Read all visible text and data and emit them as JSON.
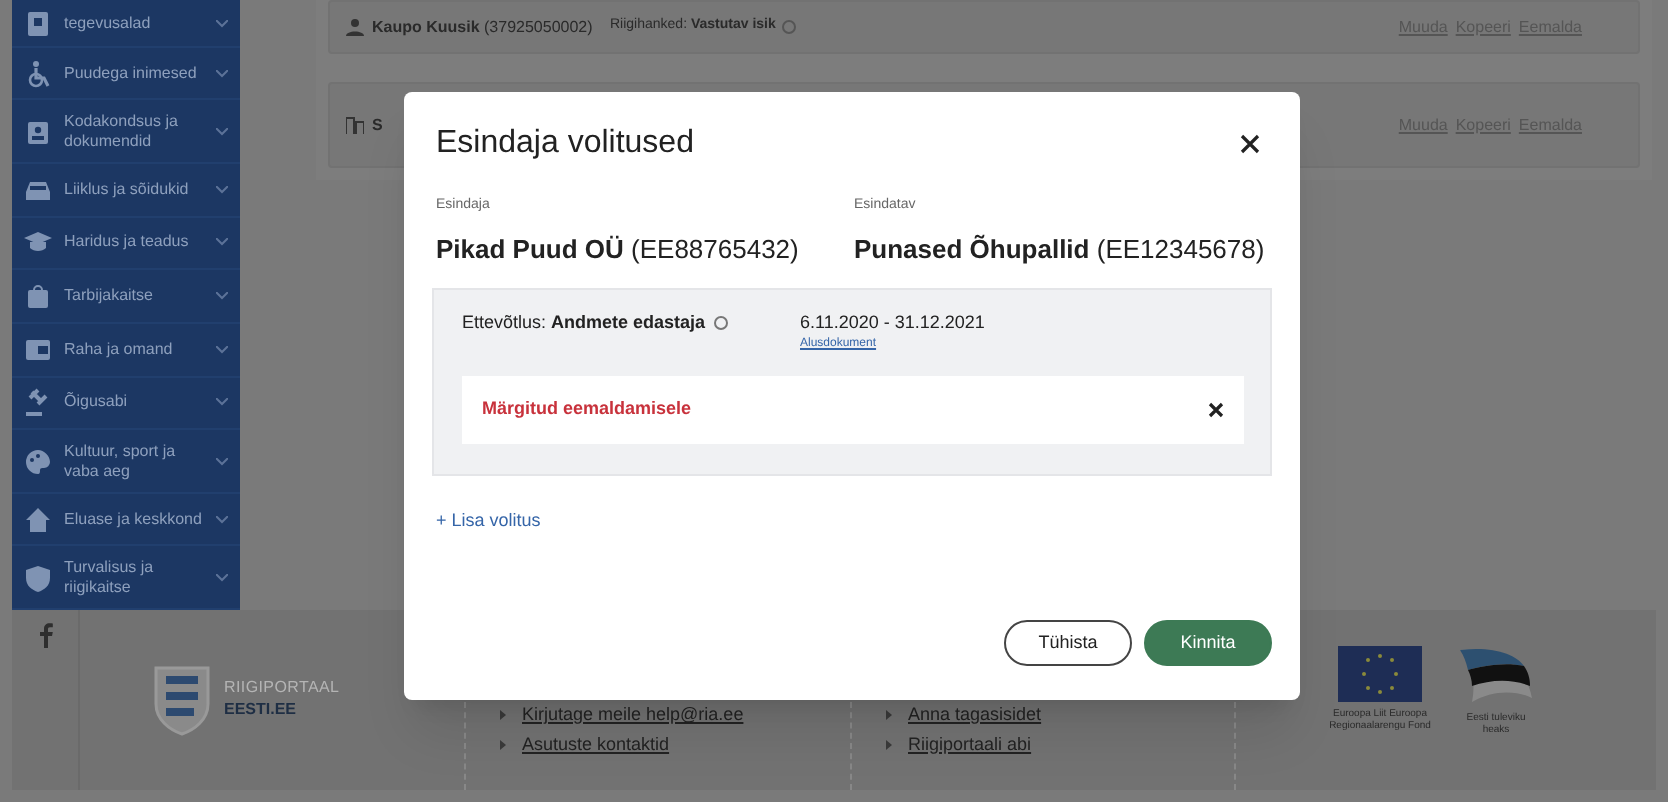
{
  "sidebar": {
    "items": [
      {
        "label": "tegevusalad"
      },
      {
        "label": "Puudega inimesed"
      },
      {
        "label": "Kodakondsus ja dokumendid"
      },
      {
        "label": "Liiklus ja sõidukid"
      },
      {
        "label": "Haridus ja teadus"
      },
      {
        "label": "Tarbijakaitse"
      },
      {
        "label": "Raha ja omand"
      },
      {
        "label": "Õigusabi"
      },
      {
        "label": "Kultuur, sport ja vaba aeg"
      },
      {
        "label": "Eluase ja keskkond"
      },
      {
        "label": "Turvalisus ja riigikaitse"
      }
    ]
  },
  "cards": [
    {
      "name": "**Kaupo Kuusik** (37925050002)",
      "role": "Riigihanked: **Vastutav isik**",
      "actions": [
        "Muuda",
        "Kopeeri",
        "Eemalda"
      ]
    },
    {
      "name": "**S**",
      "actions": [
        "Muuda",
        "Kopeeri",
        "Eemalda"
      ]
    }
  ],
  "footer": {
    "logo": [
      "RIIGIPORTAAL",
      "EESTI.EE"
    ],
    "link_columns": [
      [
        "Kirjutage meile help@ria.ee",
        "Asutuste kontaktid"
      ],
      [
        "Anna tagasisidet",
        "Riigiportaali abi"
      ]
    ],
    "eu_caption": "Euroopa Liit Euroopa Regionaalarengu Fond",
    "ee_caption": "Eesti tuleviku heaks"
  },
  "modal": {
    "title": "Esindaja volitused",
    "parties": [
      {
        "label": "Esindaja",
        "name": "**Pikad Puud OÜ** (EE88765432)"
      },
      {
        "label": "Esindatav",
        "name": "**Punased Õhupallid** (EE12345678)"
      }
    ],
    "permissions": [
      {
        "role": "Ettevõtlus: **Andmete edastaja**",
        "period": "6.11.2020 - 31.12.2021",
        "link": "Alusdokument",
        "notice": "Märgitud eemaldamisele"
      }
    ],
    "add_link": "+ Lisa volitus",
    "buttons": [
      {
        "label": "Tühista",
        "kind": "secondary"
      },
      {
        "label": "Kinnita",
        "kind": "primary"
      }
    ]
  }
}
